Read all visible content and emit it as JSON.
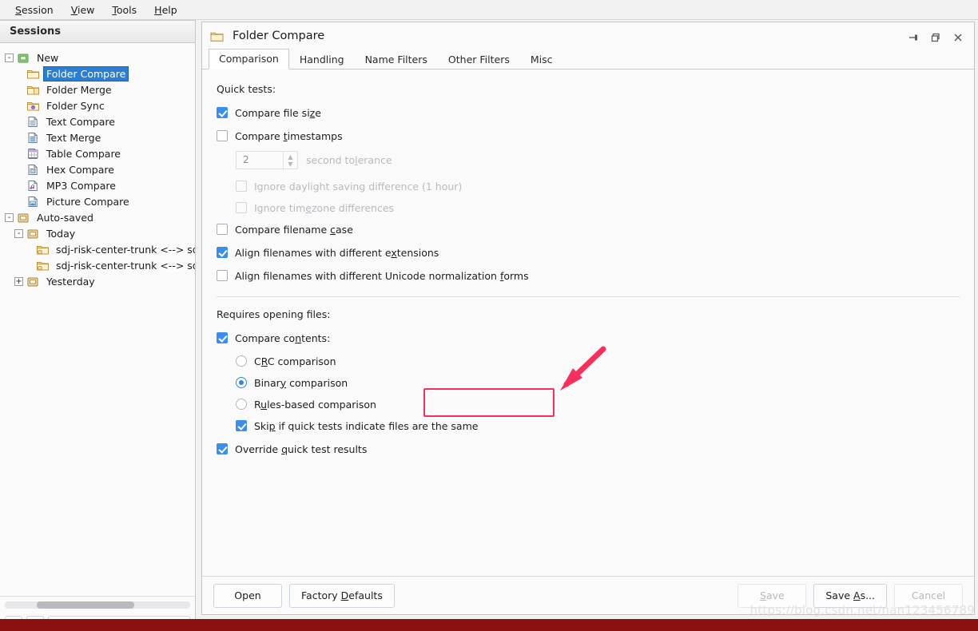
{
  "menubar": [
    {
      "label": "Session",
      "mnemonic": "S"
    },
    {
      "label": "View",
      "mnemonic": "V"
    },
    {
      "label": "Tools",
      "mnemonic": "T"
    },
    {
      "label": "Help",
      "mnemonic": "H"
    }
  ],
  "sidebar": {
    "header": "Sessions",
    "tree": [
      {
        "label": "New",
        "icon": "folder-new-icon",
        "level": 0,
        "expander": "-",
        "selected": false
      },
      {
        "label": "Folder Compare",
        "icon": "folder-compare-icon",
        "level": 1,
        "expander": "",
        "selected": true
      },
      {
        "label": "Folder Merge",
        "icon": "folder-merge-icon",
        "level": 1,
        "expander": "",
        "selected": false
      },
      {
        "label": "Folder Sync",
        "icon": "folder-sync-icon",
        "level": 1,
        "expander": "",
        "selected": false
      },
      {
        "label": "Text Compare",
        "icon": "text-compare-icon",
        "level": 1,
        "expander": "",
        "selected": false
      },
      {
        "label": "Text Merge",
        "icon": "text-merge-icon",
        "level": 1,
        "expander": "",
        "selected": false
      },
      {
        "label": "Table Compare",
        "icon": "table-compare-icon",
        "level": 1,
        "expander": "",
        "selected": false
      },
      {
        "label": "Hex Compare",
        "icon": "hex-compare-icon",
        "level": 1,
        "expander": "",
        "selected": false
      },
      {
        "label": "MP3 Compare",
        "icon": "mp3-compare-icon",
        "level": 1,
        "expander": "",
        "selected": false
      },
      {
        "label": "Picture Compare",
        "icon": "picture-compare-icon",
        "level": 1,
        "expander": "",
        "selected": false
      },
      {
        "label": "Auto-saved",
        "icon": "archive-icon",
        "level": 0,
        "expander": "-",
        "selected": false
      },
      {
        "label": "Today",
        "icon": "archive-icon",
        "level": 1,
        "expander": "-",
        "selected": false
      },
      {
        "label": "sdj-risk-center-trunk <--> sdj-ri",
        "icon": "session-folder-icon",
        "level": 2,
        "expander": "",
        "selected": false
      },
      {
        "label": "sdj-risk-center-trunk <--> sdj-ri",
        "icon": "session-folder-icon",
        "level": 2,
        "expander": "",
        "selected": false
      },
      {
        "label": "Yesterday",
        "icon": "archive-icon",
        "level": 1,
        "expander": "+",
        "selected": false
      }
    ],
    "add_button": "+",
    "remove_button": "−",
    "search_placeholder": "",
    "search_value": ""
  },
  "panel": {
    "title": "Folder Compare",
    "window_buttons": [
      "pin-icon",
      "restore-icon",
      "close-icon"
    ],
    "tabs": [
      {
        "label": "Comparison",
        "active": true
      },
      {
        "label": "Handling",
        "active": false
      },
      {
        "label": "Name Filters",
        "active": false
      },
      {
        "label": "Other Filters",
        "active": false
      },
      {
        "label": "Misc",
        "active": false
      }
    ],
    "quick_tests_label": "Quick tests:",
    "quick_tests": [
      {
        "label_pre": "Compare file si",
        "mnemonic": "z",
        "label_post": "e",
        "checked": true,
        "disabled": false
      },
      {
        "label_pre": "Compare ",
        "mnemonic": "t",
        "label_post": "imestamps",
        "checked": false,
        "disabled": false
      }
    ],
    "tolerance": {
      "value": "2",
      "label_pre": "second to",
      "mnemonic": "l",
      "label_post": "erance",
      "disabled": true
    },
    "timestamp_sub": [
      {
        "label_pre": "Ignore daylight saving difference (1 hour)",
        "mnemonic": "",
        "label_post": "",
        "checked": false,
        "disabled": true
      },
      {
        "label_pre": "Ignore tim",
        "mnemonic": "e",
        "label_post": "zone differences",
        "checked": false,
        "disabled": true
      }
    ],
    "quick_tests_rest": [
      {
        "label_pre": "Compare filename ",
        "mnemonic": "c",
        "label_post": "ase",
        "checked": false,
        "disabled": false
      },
      {
        "label_pre": "Align filenames with different e",
        "mnemonic": "x",
        "label_post": "tensions",
        "checked": true,
        "disabled": false
      },
      {
        "label_pre": "Align filenames with different Unicode normalization ",
        "mnemonic": "f",
        "label_post": "orms",
        "checked": false,
        "disabled": false
      }
    ],
    "requires_label": "Requires opening files:",
    "compare_contents": {
      "label_pre": "Compare co",
      "mnemonic": "n",
      "label_post": "tents:",
      "checked": true
    },
    "comparison_modes": [
      {
        "label_pre": "C",
        "mnemonic": "R",
        "label_post": "C comparison",
        "selected": false
      },
      {
        "label_pre": "Binar",
        "mnemonic": "y",
        "label_post": " comparison",
        "selected": true
      },
      {
        "label_pre": "R",
        "mnemonic": "u",
        "label_post": "les-based comparison",
        "selected": false
      }
    ],
    "skip_option": {
      "label_pre": "Ski",
      "mnemonic": "p",
      "label_post": " if quick tests indicate files are the same",
      "checked": true
    },
    "override_option": {
      "label_pre": "Override ",
      "mnemonic": "q",
      "label_post": "uick test results",
      "checked": true
    }
  },
  "footer": {
    "open": {
      "label_pre": "Open",
      "mnemonic": "",
      "label_post": "",
      "disabled": false
    },
    "factory_defaults": {
      "label_pre": "Factory ",
      "mnemonic": "D",
      "label_post": "efaults",
      "disabled": false
    },
    "save": {
      "label_pre": "",
      "mnemonic": "S",
      "label_post": "ave",
      "disabled": true
    },
    "save_as": {
      "label_pre": "Save ",
      "mnemonic": "A",
      "label_post": "s...",
      "disabled": false
    },
    "cancel": {
      "label_pre": "Cancel",
      "mnemonic": "",
      "label_post": "",
      "disabled": true
    }
  },
  "watermark": "https://blog.csdn.net/nan123456789",
  "colors": {
    "accent_blue": "#3b8eea",
    "selection_blue": "#2a7fd4",
    "annotation_red": "#f5305c",
    "bottom_bar": "#8b1010",
    "panel_bg": "#fafafa"
  }
}
